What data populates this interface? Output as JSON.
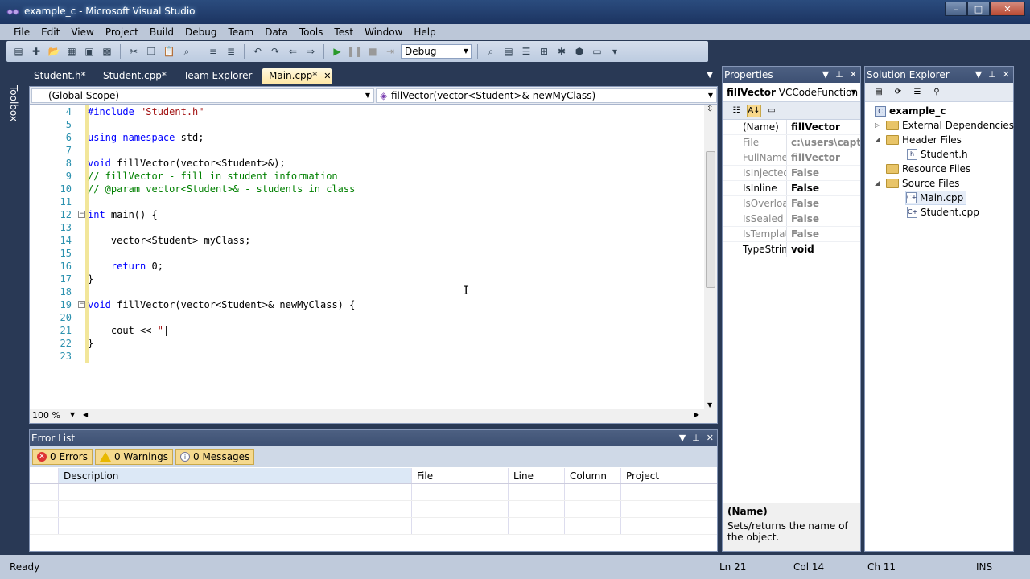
{
  "window": {
    "title": "example_c - Microsoft Visual Studio",
    "min": "‒",
    "max": "□",
    "close": "✕"
  },
  "menu": [
    "File",
    "Edit",
    "View",
    "Project",
    "Build",
    "Debug",
    "Team",
    "Data",
    "Tools",
    "Test",
    "Window",
    "Help"
  ],
  "toolbar": {
    "config": "Debug"
  },
  "toolbox_label": "Toolbox",
  "tabs": [
    {
      "label": "Student.h*"
    },
    {
      "label": "Student.cpp*"
    },
    {
      "label": "Team Explorer"
    },
    {
      "label": "Main.cpp*",
      "close": "✕"
    }
  ],
  "editor": {
    "scope": "(Global Scope)",
    "member": "fillVector(vector<Student>& newMyClass)",
    "zoom": "100 %",
    "lines": [
      {
        "n": "4",
        "html": "<span class='kw'>#include</span> <span class='st'>\"Student.h\"</span>"
      },
      {
        "n": "5",
        "html": ""
      },
      {
        "n": "6",
        "html": "<span class='kw'>using namespace</span> std;"
      },
      {
        "n": "7",
        "html": ""
      },
      {
        "n": "8",
        "html": "<span class='kw'>void</span> fillVector(vector&lt;Student&gt;&amp;);"
      },
      {
        "n": "9",
        "html": "<span class='cm'>// fillVector - fill in student information</span>"
      },
      {
        "n": "10",
        "html": "<span class='cm'>// @param vector&lt;Student&gt;&amp; - students in class</span>"
      },
      {
        "n": "11",
        "html": ""
      },
      {
        "n": "12",
        "html": "<span class='kw'>int</span> main() {",
        "fold": true
      },
      {
        "n": "13",
        "html": ""
      },
      {
        "n": "14",
        "html": "    vector&lt;Student&gt; myClass;"
      },
      {
        "n": "15",
        "html": ""
      },
      {
        "n": "16",
        "html": "    <span class='kw'>return</span> 0;"
      },
      {
        "n": "17",
        "html": "}"
      },
      {
        "n": "18",
        "html": ""
      },
      {
        "n": "19",
        "html": "<span class='kw'>void</span> fillVector(vector&lt;Student&gt;&amp; newMyClass) {",
        "fold": true
      },
      {
        "n": "20",
        "html": ""
      },
      {
        "n": "21",
        "html": "    cout &lt;&lt; <span class='st'>\"</span>|"
      },
      {
        "n": "22",
        "html": "}"
      },
      {
        "n": "23",
        "html": ""
      }
    ]
  },
  "errorlist": {
    "title": "Error List",
    "errors": "0 Errors",
    "warnings": "0 Warnings",
    "messages": "0 Messages",
    "columns": [
      "Description",
      "File",
      "Line",
      "Column",
      "Project"
    ]
  },
  "properties": {
    "title": "Properties",
    "object_name": "fillVector",
    "object_type": "VCCodeFunction",
    "rows": [
      {
        "k": "(Name)",
        "v": "fillVector",
        "dark": true
      },
      {
        "k": "File",
        "v": "c:\\users\\captain",
        "dark": false
      },
      {
        "k": "FullName",
        "v": "fillVector",
        "dark": false
      },
      {
        "k": "IsInjected",
        "v": "False",
        "dark": false
      },
      {
        "k": "IsInline",
        "v": "False",
        "dark": true
      },
      {
        "k": "IsOverloaded",
        "v": "False",
        "dark": false
      },
      {
        "k": "IsSealed",
        "v": "False",
        "dark": false
      },
      {
        "k": "IsTemplate",
        "v": "False",
        "dark": false
      },
      {
        "k": "TypeString",
        "v": "void",
        "dark": true
      }
    ],
    "desc_title": "(Name)",
    "desc_text": "Sets/returns the name of the object."
  },
  "solution": {
    "title": "Solution Explorer",
    "project": "example_c",
    "external": "External Dependencies",
    "header_files": "Header Files",
    "student_h": "Student.h",
    "resource_files": "Resource Files",
    "source_files": "Source Files",
    "main_cpp": "Main.cpp",
    "student_cpp": "Student.cpp"
  },
  "status": {
    "ready": "Ready",
    "ln": "Ln 21",
    "col": "Col 14",
    "ch": "Ch 11",
    "ins": "INS"
  }
}
